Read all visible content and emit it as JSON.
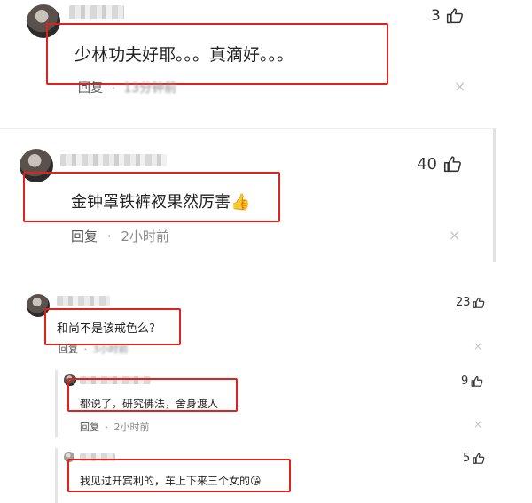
{
  "comments": [
    {
      "text": "少林功夫好耶。。。真滴好。。。",
      "likes": "3",
      "reply_label": "回复",
      "separator": "·",
      "time": "13分钟前",
      "close": "×"
    },
    {
      "text": "金钟罩铁裤衩果然厉害👍",
      "likes": "40",
      "reply_label": "回复",
      "separator": "·",
      "time": "2小时前",
      "close": "×"
    },
    {
      "text": "和尚不是该戒色么?",
      "likes": "23",
      "reply_label": "回复",
      "separator": "·",
      "time": "3小时前",
      "close": "×",
      "replies": [
        {
          "text": "都说了，研究佛法，舍身渡人",
          "likes": "9",
          "reply_label": "回复",
          "separator": "·",
          "time": "2小时前",
          "close": "×"
        },
        {
          "text": "我见过开宾利的，车上下来三个女的😘",
          "likes": "5"
        }
      ]
    }
  ],
  "colors": {
    "highlight": "#e0221c",
    "meta_text": "#8a8a8a",
    "divider": "#e2e2e2"
  },
  "icons": {
    "like": "thumbs-up-icon",
    "close": "close-icon"
  }
}
